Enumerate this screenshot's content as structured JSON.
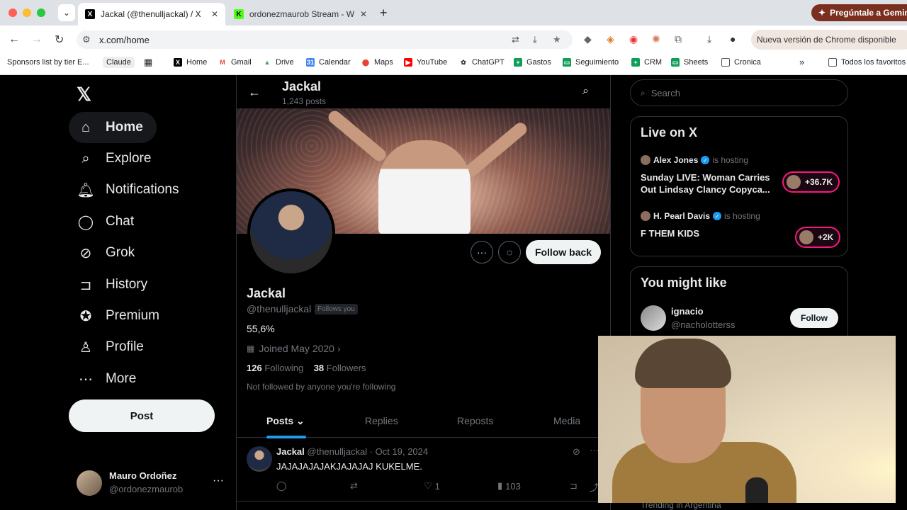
{
  "browser": {
    "tabs": [
      {
        "title": "Jackal (@thenulljackal) / X",
        "icon": "X"
      },
      {
        "title": "ordonezmaurob Stream - Wat",
        "icon": "K"
      }
    ],
    "gemini_label": "Pregúntale a Gemini",
    "url": "x.com/home",
    "update_label": "Nueva versión de Chrome disponible",
    "bookmarks": {
      "sponsors": "Sponsors list by tier E...",
      "claude": "Claude",
      "home": "Home",
      "gmail": "Gmail",
      "drive": "Drive",
      "calendar": "Calendar",
      "maps": "Maps",
      "youtube": "YouTube",
      "chatgpt": "ChatGPT",
      "gastos": "Gastos",
      "seguimiento": "Seguimiento",
      "crm": "CRM",
      "sheets": "Sheets",
      "cronica": "Cronica",
      "all": "Todos los favoritos"
    }
  },
  "sidebar": {
    "items": [
      {
        "label": "Home",
        "icon": "home-icon"
      },
      {
        "label": "Explore",
        "icon": "search-icon"
      },
      {
        "label": "Notifications",
        "icon": "bell-icon"
      },
      {
        "label": "Chat",
        "icon": "chat-icon"
      },
      {
        "label": "Grok",
        "icon": "grok-icon"
      },
      {
        "label": "History",
        "icon": "bookmark-icon"
      },
      {
        "label": "Premium",
        "icon": "verified-icon"
      },
      {
        "label": "Profile",
        "icon": "person-icon"
      },
      {
        "label": "More",
        "icon": "more-icon"
      }
    ],
    "post_label": "Post",
    "account": {
      "name": "Mauro Ordoñez",
      "handle": "@ordonezmaurob"
    }
  },
  "profile": {
    "top_name": "Jackal",
    "top_posts": "1,243 posts",
    "name": "Jackal",
    "handle": "@thenulljackal",
    "follows_you": "Follows you",
    "bio": "55,6%",
    "joined": "Joined May 2020",
    "following_count": "126",
    "following_label": "Following",
    "followers_count": "38",
    "followers_label": "Followers",
    "not_followed": "Not followed by anyone you're following",
    "follow_back": "Follow back",
    "tabs": [
      "Posts",
      "Replies",
      "Reposts",
      "Media"
    ]
  },
  "tweet": {
    "name": "Jackal",
    "meta": "@thenulljackal · Oct 19, 2024",
    "text": "JAJAJAJAJAKJAJAJAJ KUKELME.",
    "likes": "1",
    "views": "103"
  },
  "right": {
    "search_placeholder": "Search",
    "live": {
      "title": "Live on X",
      "items": [
        {
          "host": "Alex Jones",
          "hosting": "is hosting",
          "title": "Sunday LIVE: Woman Carries Out Lindsay Clancy Copyca...",
          "count": "+36.7K"
        },
        {
          "host": "H. Pearl Davis",
          "hosting": "is hosting",
          "title": "F THEM KIDS",
          "count": "+2K"
        }
      ]
    },
    "suggest": {
      "title": "You might like",
      "name": "ignacio",
      "handle": "@nacholotterss",
      "follow": "Follow"
    },
    "trending": "Trending in Argentina"
  },
  "colors": {
    "accent": "#1d9bf0",
    "live": "#f91880",
    "background": "#000000"
  }
}
